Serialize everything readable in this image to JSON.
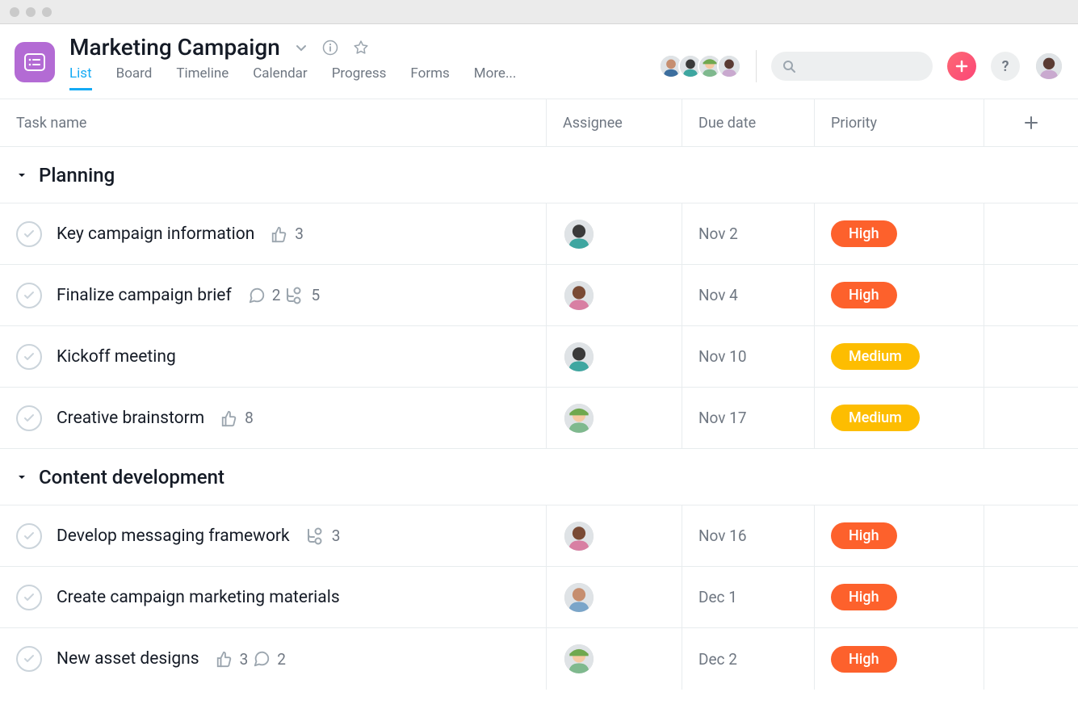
{
  "project": {
    "title": "Marketing Campaign"
  },
  "tabs": [
    "List",
    "Board",
    "Timeline",
    "Calendar",
    "Progress",
    "Forms",
    "More..."
  ],
  "activeTab": 0,
  "columns": {
    "task": "Task name",
    "assignee": "Assignee",
    "due": "Due date",
    "priority": "Priority"
  },
  "priorities": {
    "high": "High",
    "medium": "Medium"
  },
  "members": [
    "m1",
    "m2",
    "m3",
    "m4"
  ],
  "sections": [
    {
      "title": "Planning",
      "tasks": [
        {
          "name": "Key campaign information",
          "likes": "3",
          "comments": null,
          "subtasks": null,
          "assignee": "a1",
          "due": "Nov 2",
          "priority": "high"
        },
        {
          "name": "Finalize campaign brief",
          "likes": null,
          "comments": "2",
          "subtasks": "5",
          "assignee": "a2",
          "due": "Nov 4",
          "priority": "high"
        },
        {
          "name": "Kickoff meeting",
          "likes": null,
          "comments": null,
          "subtasks": null,
          "assignee": "a1",
          "due": "Nov 10",
          "priority": "medium"
        },
        {
          "name": "Creative brainstorm",
          "likes": "8",
          "comments": null,
          "subtasks": null,
          "assignee": "a3",
          "due": "Nov 17",
          "priority": "medium"
        }
      ]
    },
    {
      "title": "Content development",
      "tasks": [
        {
          "name": "Develop messaging framework",
          "likes": null,
          "comments": null,
          "subtasks": "3",
          "assignee": "a2",
          "due": "Nov 16",
          "priority": "high"
        },
        {
          "name": "Create campaign marketing materials",
          "likes": null,
          "comments": null,
          "subtasks": null,
          "assignee": "a4",
          "due": "Dec 1",
          "priority": "high"
        },
        {
          "name": "New asset designs",
          "likes": "3",
          "comments": "2",
          "subtasks": null,
          "assignee": "a3",
          "due": "Dec 2",
          "priority": "high"
        }
      ]
    }
  ],
  "avatar_colors": {
    "m1": {
      "bg": "#c68e6f",
      "shirt": "#3c6e9e"
    },
    "m2": {
      "bg": "#3a3a3a",
      "shirt": "#3ea6a0"
    },
    "m3": {
      "bg": "#f5c9a2",
      "shirt": "#7fb98e",
      "cap": "#6fa84f"
    },
    "m4": {
      "bg": "#5a3b33",
      "shirt": "#c9a9cf"
    },
    "a1": {
      "bg": "#3a3a3a",
      "shirt": "#3ea6a0"
    },
    "a2": {
      "bg": "#7a4b35",
      "shirt": "#d87fa3"
    },
    "a3": {
      "bg": "#f5c9a2",
      "shirt": "#7fb98e",
      "cap": "#6fa84f"
    },
    "a4": {
      "bg": "#c68e6f",
      "shirt": "#7aa5c9"
    }
  }
}
